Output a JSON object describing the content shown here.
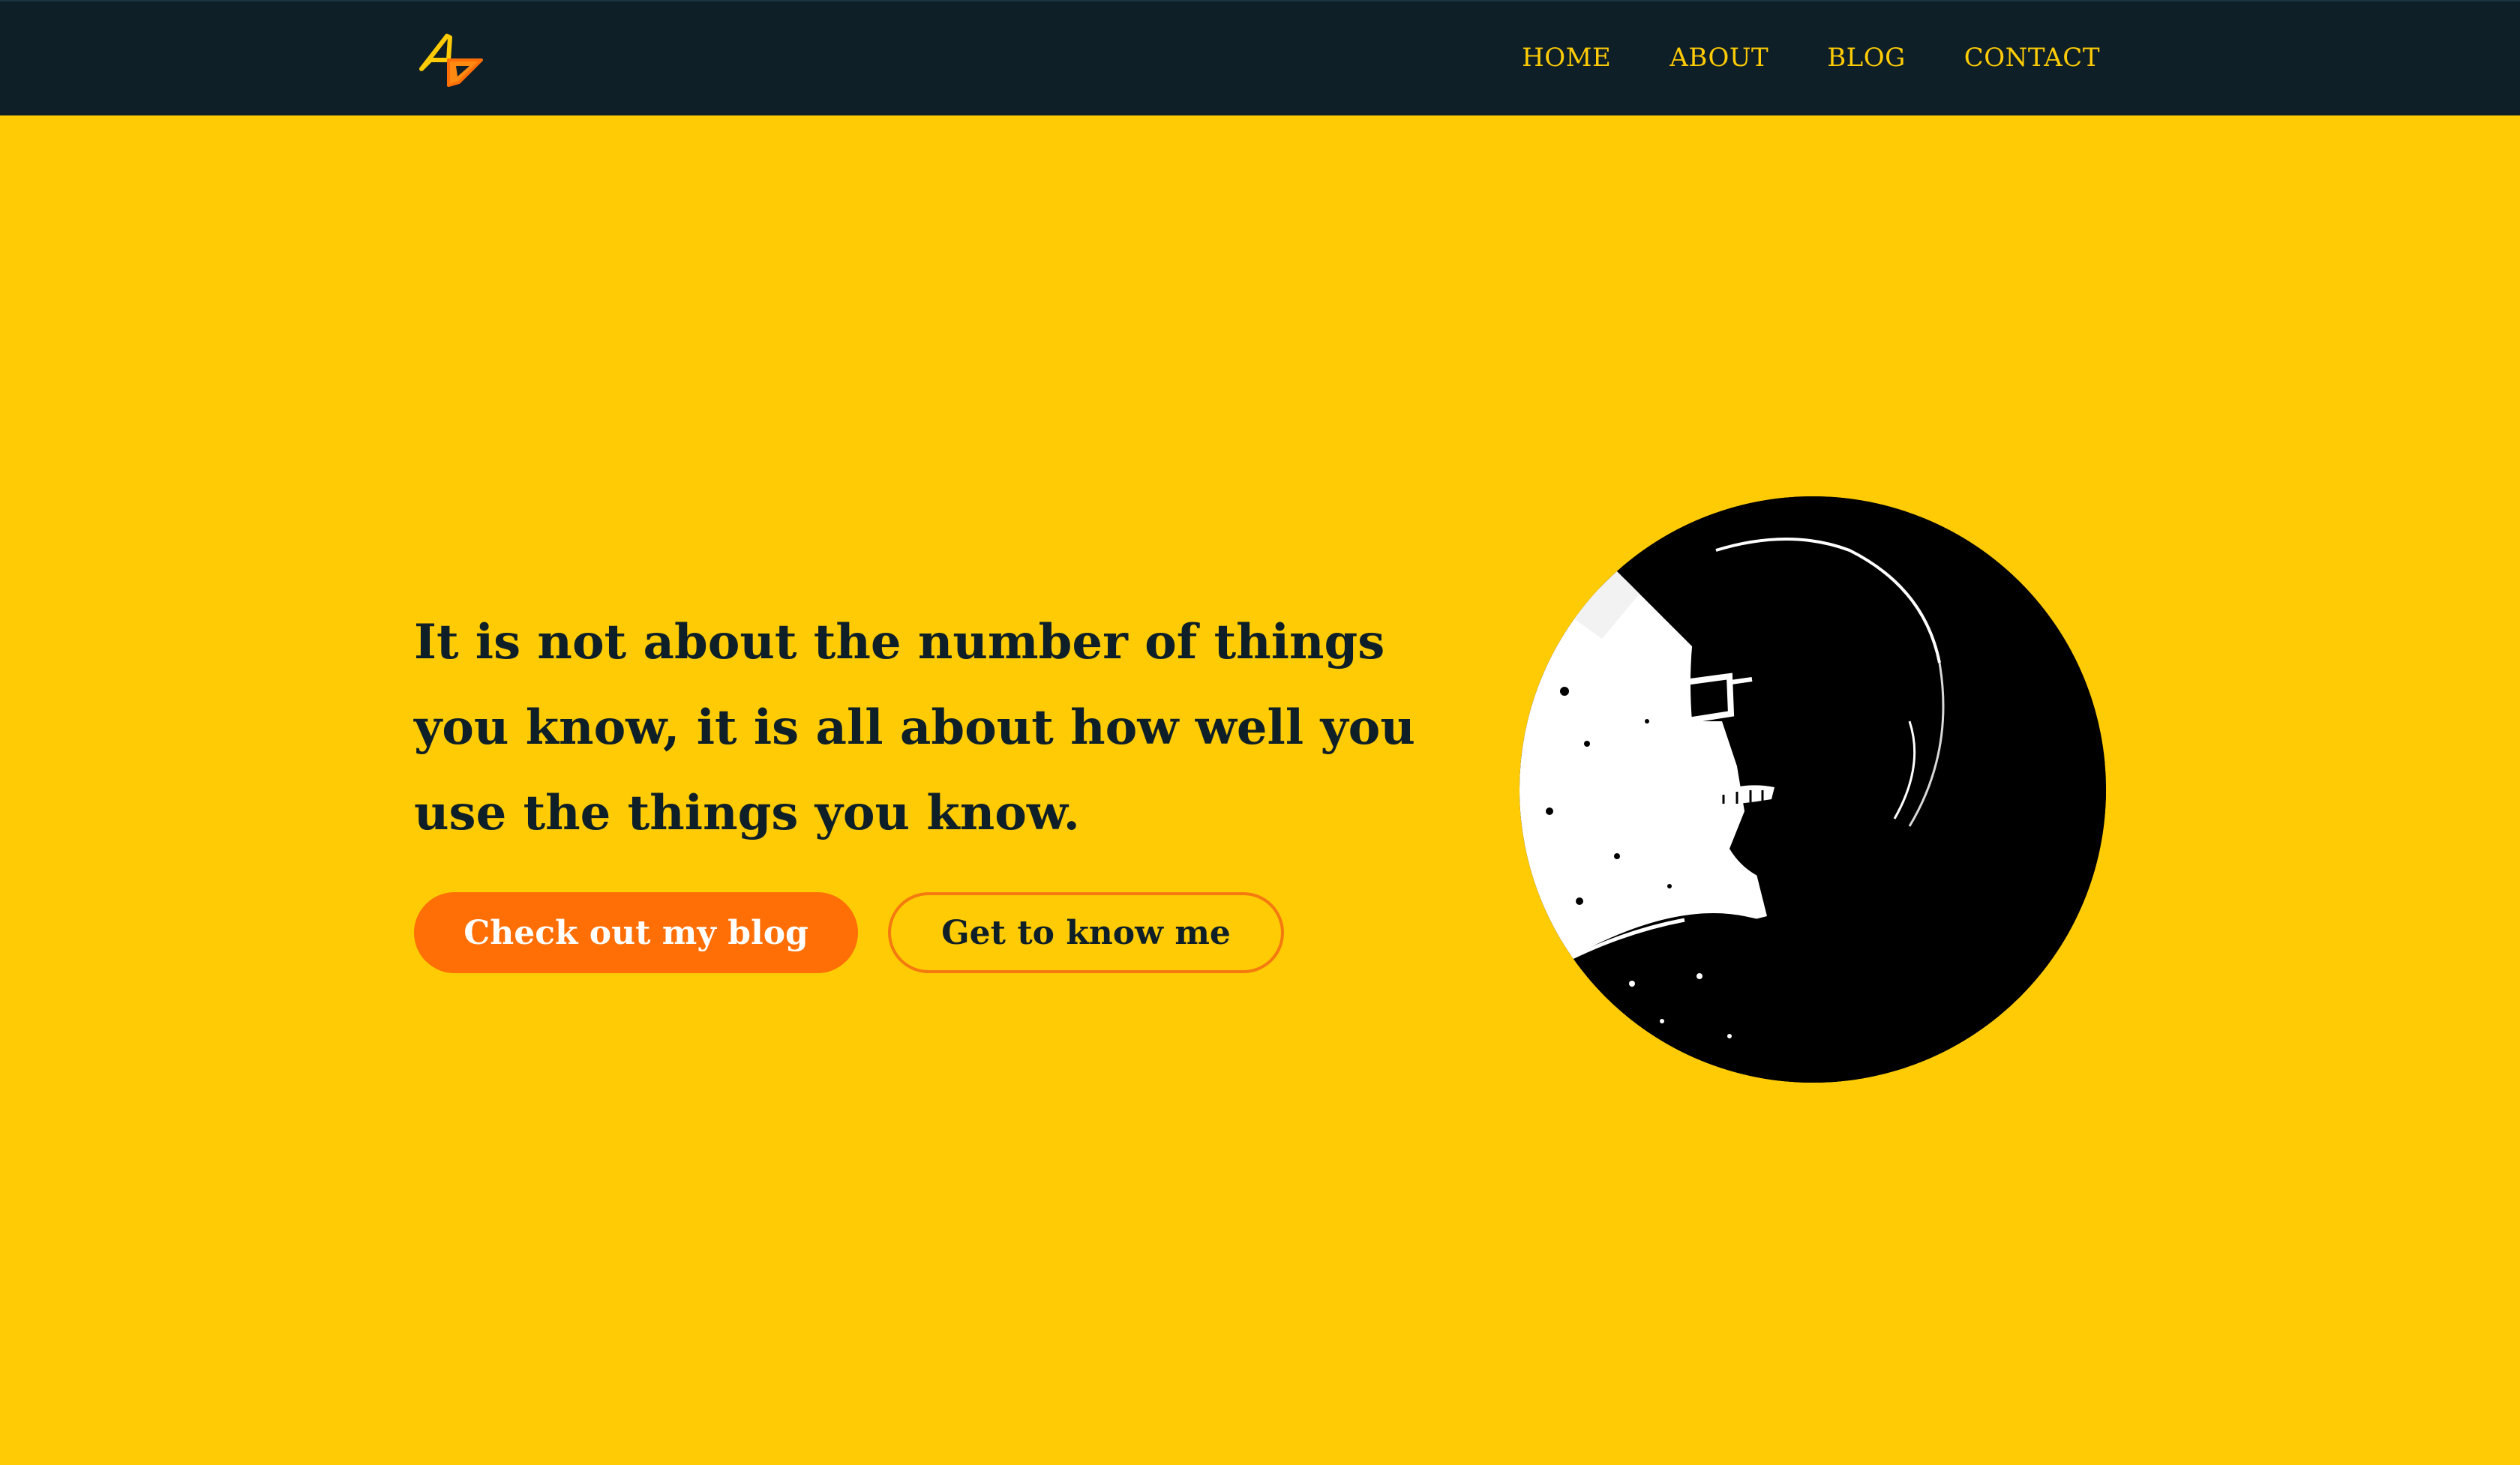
{
  "nav": {
    "logo_icon": "ap-monogram-logo-icon",
    "links": [
      {
        "label": "HOME"
      },
      {
        "label": "ABOUT"
      },
      {
        "label": "BLOG"
      },
      {
        "label": "CONTACT"
      }
    ]
  },
  "hero": {
    "quote": "It is not about the number of things you know, it is all about how well you use the things you know.",
    "primary_button": "Check out my blog",
    "secondary_button": "Get to know me",
    "portrait_icon": "profile-photo"
  },
  "colors": {
    "background": "#fecb04",
    "navbar": "#0e1f28",
    "nav_text": "#fecb04",
    "primary_button": "#ff6f06",
    "text_dark": "#0e1f28"
  }
}
